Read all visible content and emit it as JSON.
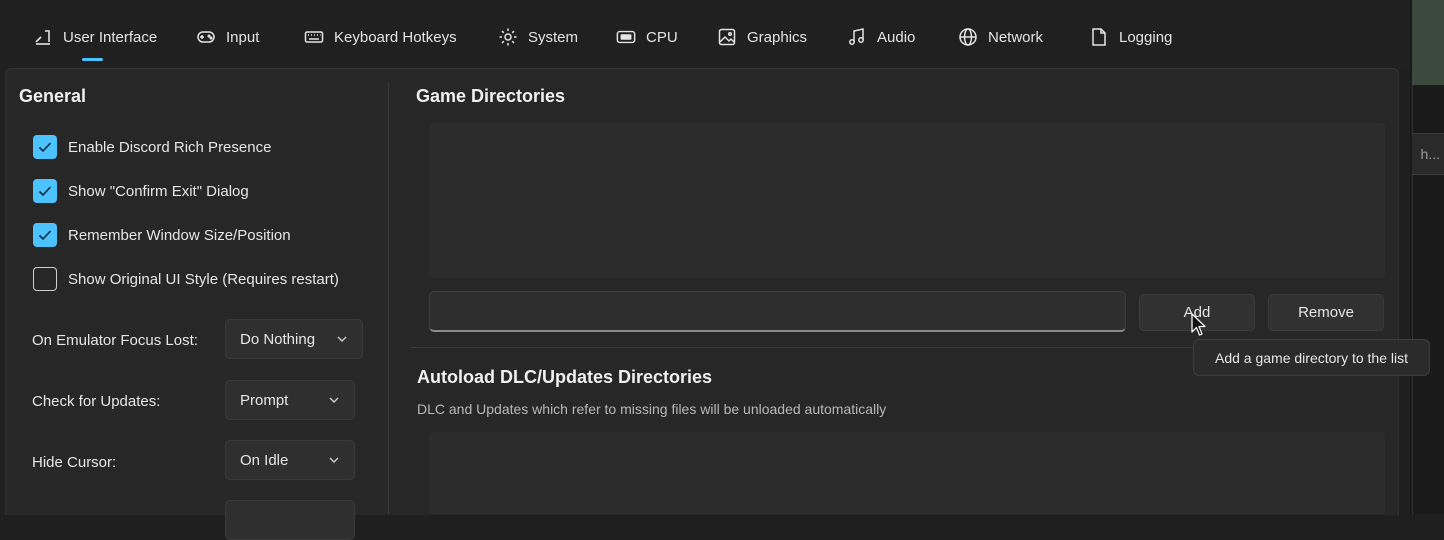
{
  "tabs": [
    {
      "label": "User Interface",
      "icon": "user-interface-icon"
    },
    {
      "label": "Input",
      "icon": "gamepad-icon"
    },
    {
      "label": "Keyboard Hotkeys",
      "icon": "keyboard-icon"
    },
    {
      "label": "System",
      "icon": "gear-icon"
    },
    {
      "label": "CPU",
      "icon": "cpu-icon"
    },
    {
      "label": "Graphics",
      "icon": "image-icon"
    },
    {
      "label": "Audio",
      "icon": "music-note-icon"
    },
    {
      "label": "Network",
      "icon": "globe-icon"
    },
    {
      "label": "Logging",
      "icon": "document-icon"
    }
  ],
  "general": {
    "title": "General",
    "checkboxes": [
      {
        "label": "Enable Discord Rich Presence",
        "checked": true
      },
      {
        "label": "Show \"Confirm Exit\" Dialog",
        "checked": true
      },
      {
        "label": "Remember Window Size/Position",
        "checked": true
      },
      {
        "label": "Show Original UI Style (Requires restart)",
        "checked": false
      }
    ],
    "options": [
      {
        "label": "On Emulator Focus Lost:",
        "value": "Do Nothing"
      },
      {
        "label": "Check for Updates:",
        "value": "Prompt"
      },
      {
        "label": "Hide Cursor:",
        "value": "On Idle"
      }
    ]
  },
  "game_dirs": {
    "title": "Game Directories",
    "path_value": "",
    "add_label": "Add",
    "remove_label": "Remove",
    "tooltip": "Add a game directory to the list"
  },
  "autoload": {
    "title": "Autoload DLC/Updates Directories",
    "description": "DLC and Updates which refer to missing files will be unloaded automatically"
  },
  "background": {
    "truncated_text": "h..."
  },
  "colors": {
    "accent": "#4cc2ff",
    "panel": "#272727",
    "window": "#1f1f1f"
  }
}
